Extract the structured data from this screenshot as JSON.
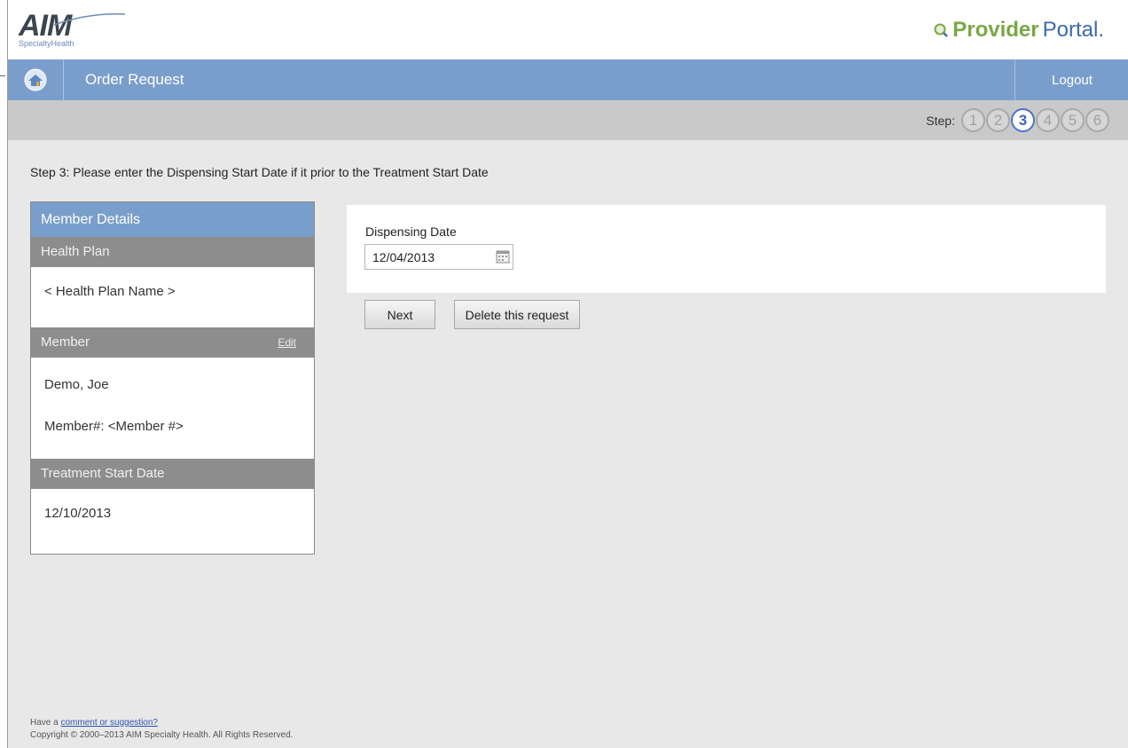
{
  "header": {
    "logo_text": "AIM",
    "logo_subtext": "SpecialtyHealth",
    "portal_part1": "Provider",
    "portal_part2": "Portal."
  },
  "nav": {
    "title": "Order Request",
    "logout": "Logout"
  },
  "steps": {
    "label": "Step:",
    "items": [
      "1",
      "2",
      "3",
      "4",
      "5",
      "6"
    ],
    "active": 3
  },
  "instruction": "Step 3: Please enter the Dispensing Start Date if it prior to the Treatment Start Date",
  "member_panel": {
    "title": "Member Details",
    "health_plan_head": "Health Plan",
    "health_plan_value": "< Health Plan Name >",
    "member_head": "Member",
    "edit_link": "Edit",
    "member_name": "Demo, Joe",
    "member_number": "Member#:  <Member #>",
    "treatment_head": "Treatment Start Date",
    "treatment_value": "12/10/2013"
  },
  "form": {
    "dispensing_label": "Dispensing Date",
    "dispensing_value": "12/04/2013",
    "next_button": "Next",
    "delete_button": "Delete this request"
  },
  "footer": {
    "prefix": "Have a ",
    "link": "comment or suggestion?",
    "copyright": "Copyright © 2000–2013 AIM Specialty Health. All Rights Reserved."
  },
  "colors": {
    "nav_blue": "#7a9ecb",
    "section_gray": "#8d8d8d",
    "portal_green": "#7aa845",
    "portal_blue": "#3b6aa8",
    "active_step": "#4b73c6"
  }
}
